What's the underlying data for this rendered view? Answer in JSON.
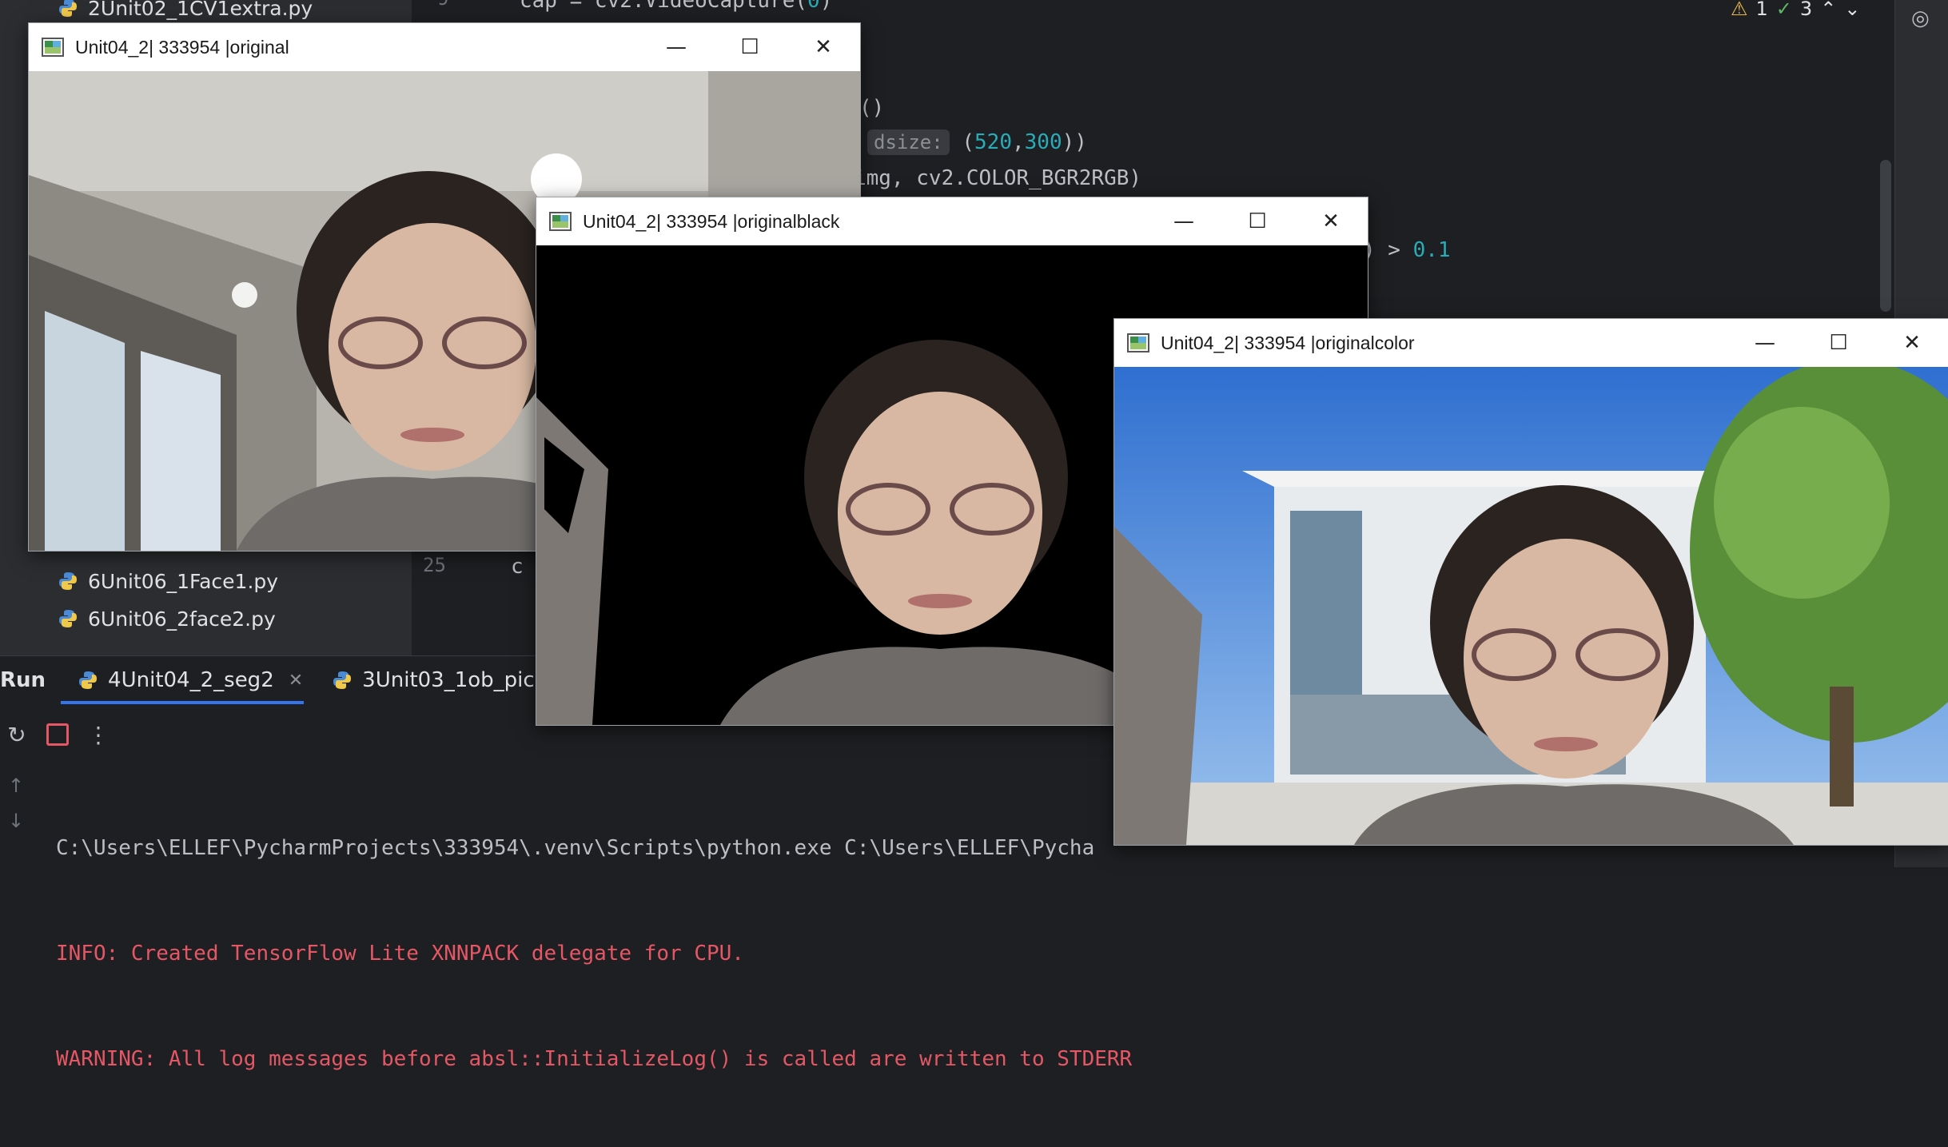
{
  "ide": {
    "project_files": [
      {
        "name": "2Unit02_1CV1extra.py"
      },
      {
        "name": "6Unit06_1Face1.py"
      },
      {
        "name": "6Unit06_2face2.py"
      }
    ],
    "line_numbers": {
      "top": "9",
      "bottom": "25"
    },
    "code": {
      "line1_pre": "cap = cv2.VideoCapture(",
      "line1_num": "0",
      "line1_post": ")",
      "line2": "ead()",
      "line3_hint": "dsize:",
      "line3_pre": " (",
      "line3_n1": "520",
      "line3_sep": ",",
      "line3_n2": "300",
      "line3_post": "))",
      "line4": "img, cv2.COLOR_BGR2RGB)",
      "line5_pre": ") > ",
      "line5_num": "0.1",
      "line25_frag": "c"
    },
    "inspections": {
      "warnings": "1",
      "ok": "3"
    },
    "run": {
      "title": "Run",
      "tabs": [
        {
          "label": "4Unit04_2_seg2"
        },
        {
          "label": "3Unit03_1ob_pic"
        }
      ],
      "console": [
        "C:\\Users\\ELLEF\\PycharmProjects\\333954\\.venv\\Scripts\\python.exe C:\\Users\\ELLEF\\Pycha",
        "INFO: Created TensorFlow Lite XNNPACK delegate for CPU.",
        "WARNING: All log messages before absl::InitializeLog() is called are written to STDERR"
      ]
    }
  },
  "windows": [
    {
      "title": "Unit04_2| 333954 |original"
    },
    {
      "title": "Unit04_2| 333954 |originalblack"
    },
    {
      "title": "Unit04_2| 333954 |originalcolor"
    }
  ],
  "colors": {
    "ide_bg": "#1e1f22",
    "panel_bg": "#2b2d30",
    "accent": "#3574f0",
    "error_text": "#e55765",
    "number": "#2aacb8"
  }
}
